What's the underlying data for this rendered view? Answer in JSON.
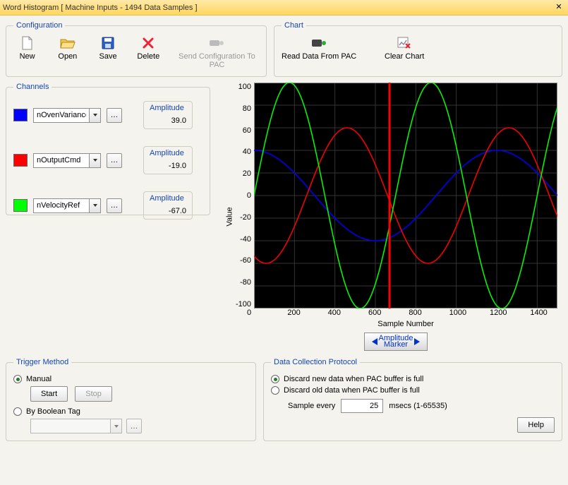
{
  "window": {
    "title": "Word Histogram [ Machine Inputs - 1494 Data Samples ]"
  },
  "configuration": {
    "legend": "Configuration",
    "new": "New",
    "open": "Open",
    "save": "Save",
    "delete": "Delete",
    "send": "Send Configuration To PAC"
  },
  "chart_group": {
    "legend": "Chart",
    "read": "Read Data From PAC",
    "clear": "Clear Chart"
  },
  "channels": {
    "legend": "Channels",
    "amplitude_label": "Amplitude",
    "items": [
      {
        "name": "nOvenVariance",
        "amplitude": "39.0",
        "color": "#0000ff"
      },
      {
        "name": "nOutputCmd",
        "amplitude": "-19.0",
        "color": "#ff0000"
      },
      {
        "name": "nVelocityRef",
        "amplitude": "-67.0",
        "color": "#00ff00"
      }
    ]
  },
  "chart_axes": {
    "xlabel": "Sample Number",
    "ylabel": "Value",
    "yticks": [
      "100",
      "80",
      "60",
      "40",
      "20",
      "0",
      "-20",
      "-40",
      "-60",
      "-80",
      "-100"
    ],
    "xticks": [
      "0",
      "200",
      "400",
      "600",
      "800",
      "1000",
      "1200",
      "1400"
    ]
  },
  "marker": {
    "label_top": "Amplitude",
    "label_bottom": "Marker",
    "x": 670
  },
  "trigger": {
    "legend": "Trigger Method",
    "manual": "Manual",
    "start": "Start",
    "stop": "Stop",
    "by_boolean": "By Boolean Tag"
  },
  "dcp": {
    "legend": "Data Collection Protocol",
    "discard_new": "Discard new data when PAC buffer is full",
    "discard_old": "Discard old data when PAC buffer is full",
    "sample_every": "Sample every",
    "sample_value": "25",
    "sample_units": "msecs (1-65535)"
  },
  "help": "Help",
  "chart_data": {
    "type": "line",
    "title": "",
    "xlabel": "Sample Number",
    "ylabel": "Value",
    "xlim": [
      0,
      1500
    ],
    "ylim": [
      -100,
      100
    ],
    "marker_x": 670,
    "series": [
      {
        "name": "nOvenVariance",
        "color": "#0000ff",
        "wave": "cos",
        "amplitude": 40,
        "period": 1200,
        "phase": 0
      },
      {
        "name": "nOutputCmd",
        "color": "#ff0000",
        "wave": "sin",
        "amplitude": 60,
        "period": 800,
        "phase": 260
      },
      {
        "name": "nVelocityRef",
        "color": "#00ff00",
        "wave": "sin",
        "amplitude": 100,
        "period": 700,
        "phase": 0
      }
    ],
    "marker_readings": [
      {
        "name": "nOvenVariance",
        "value": 39.0
      },
      {
        "name": "nOutputCmd",
        "value": -19.0
      },
      {
        "name": "nVelocityRef",
        "value": -67.0
      }
    ]
  }
}
